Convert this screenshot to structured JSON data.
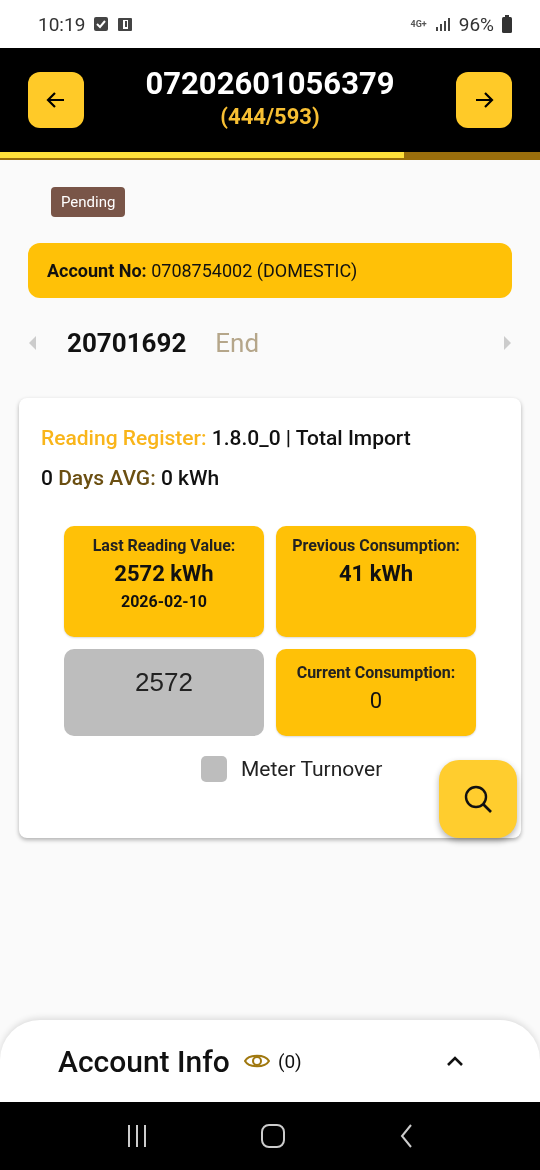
{
  "status_bar": {
    "time": "10:19",
    "network": "4G+",
    "battery": "96%"
  },
  "header": {
    "title": "07202601056379",
    "counter": "(444/593)",
    "progress": {
      "level": 0.749
    }
  },
  "status_badge": "Pending",
  "account": {
    "label": "Account No:",
    "value": "0708754002 (DOMESTIC)"
  },
  "meter": {
    "number": "20701692",
    "position": "End"
  },
  "register": {
    "label": "Reading Register:",
    "value": "1.8.0_0 | Total Import"
  },
  "average": {
    "days": "0",
    "label": "Days AVG:",
    "value": "0 kWh"
  },
  "tiles": [
    {
      "kind": "info",
      "label": "Last Reading Value:",
      "value": "2572 kWh",
      "date": "2026-02-10"
    },
    {
      "kind": "info",
      "label": "Previous Consumption:",
      "value": "41 kWh"
    },
    {
      "kind": "input",
      "value": "2572"
    },
    {
      "kind": "result",
      "label": "Current Consumption:",
      "value": "0"
    }
  ],
  "meter_turnover": {
    "label": "Meter Turnover",
    "checked": false
  },
  "account_info": {
    "title": "Account Info",
    "count": "(0)"
  }
}
